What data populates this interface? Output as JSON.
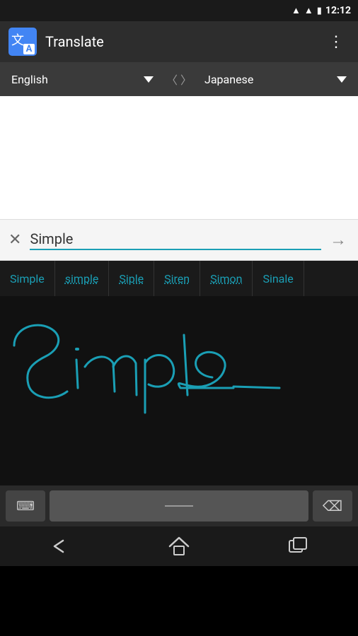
{
  "statusBar": {
    "time": "12:12",
    "wifiIcon": "wifi",
    "signalIcon": "signal",
    "batteryIcon": "battery"
  },
  "appBar": {
    "title": "Translate",
    "logoChar1": "文",
    "logoChar2": "A",
    "overflowMenu": "⋮"
  },
  "langBar": {
    "sourceLang": "English",
    "targetLang": "Japanese",
    "swapLeft": "〈",
    "swapRight": "〉"
  },
  "inputRow": {
    "clearIcon": "✕",
    "inputValue": "Simple",
    "submitIcon": "→"
  },
  "suggestions": [
    {
      "label": "Simple",
      "style": "normal"
    },
    {
      "label": "simple",
      "style": "dotted"
    },
    {
      "label": "Siple",
      "style": "dotted"
    },
    {
      "label": "Siren",
      "style": "dotted"
    },
    {
      "label": "Simon",
      "style": "dotted"
    },
    {
      "label": "Sinale",
      "style": "normal"
    }
  ],
  "keyboard": {
    "toggleIcon": "⌨",
    "backspaceIcon": "⌫"
  },
  "navBar": {
    "backLabel": "back",
    "homeLabel": "home",
    "recentLabel": "recent"
  }
}
